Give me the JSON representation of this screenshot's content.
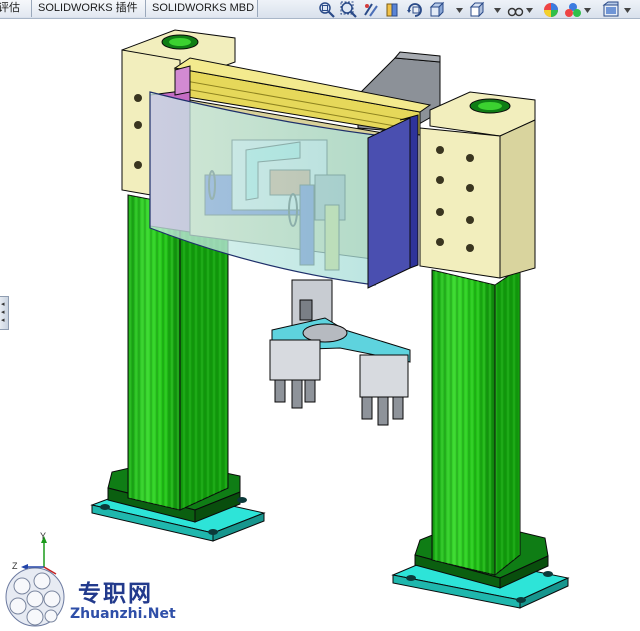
{
  "tabs": [
    {
      "label": "评估"
    },
    {
      "label": "SOLIDWORKS 插件"
    },
    {
      "label": "SOLIDWORKS MBD"
    }
  ],
  "heads_up_toolbar": [
    {
      "icon": "zoom-to-fit-icon"
    },
    {
      "icon": "zoom-to-area-icon"
    },
    {
      "icon": "previous-view-icon"
    },
    {
      "icon": "section-view-icon"
    },
    {
      "icon": "dynamic-annotation-view-icon"
    },
    {
      "icon": "view-orientation-icon"
    },
    {
      "icon": "display-style-icon"
    },
    {
      "icon": "hide-show-items-icon"
    },
    {
      "icon": "edit-appearance-icon"
    },
    {
      "icon": "apply-scene-icon"
    },
    {
      "icon": "view-settings-icon"
    }
  ],
  "triad": {
    "y_label": "Y",
    "z_label": "Z"
  },
  "watermark": {
    "cn": "专职网",
    "en": "Zhuanzhi.Net"
  },
  "colors": {
    "column": "#22c417",
    "column_dark": "#129d0d",
    "base_plate": "#2de4d8",
    "base_block": "#0f7d15",
    "mount_plate": "#f2eebd",
    "frame_yellow": "#e6d85a",
    "motor_grey": "#8c9198",
    "cover_blue": "#4a4fb0",
    "cover_magenta": "#c46cc4",
    "glass_cyan": "#9fe0dc",
    "gripper_cyan": "#5ed3de",
    "gripper_grey": "#c8ccd2"
  }
}
